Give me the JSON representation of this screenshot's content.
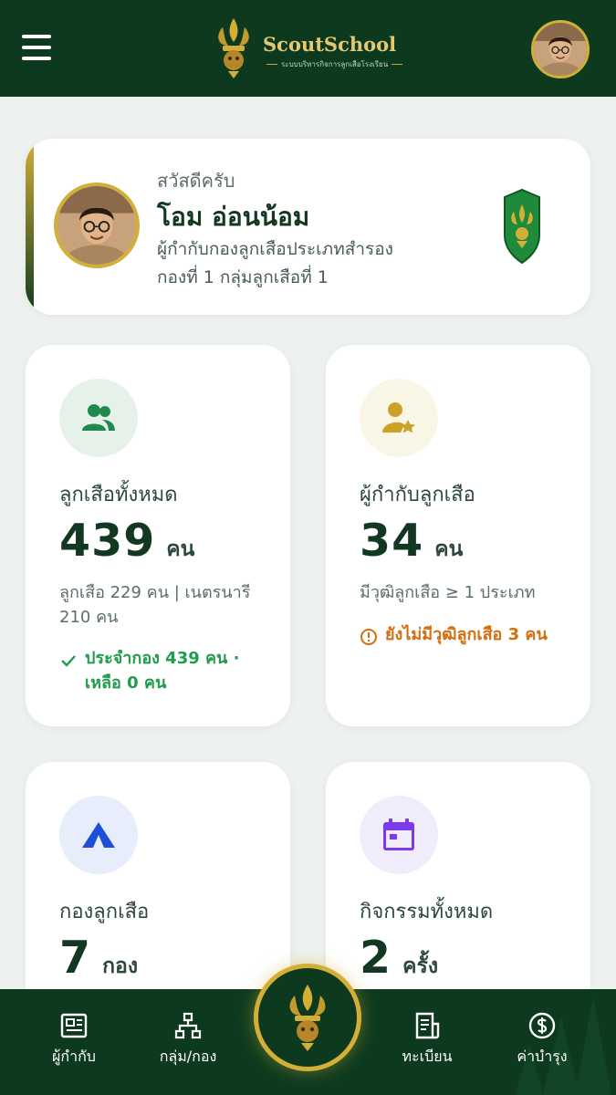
{
  "header": {
    "brand_name": "ScoutSchool",
    "brand_tagline": "ระบบบริหารกิจการลูกเสือโรงเรียน"
  },
  "profile": {
    "greeting": "สวัสดีครับ",
    "name": "โอม อ่อนน้อม",
    "role_line1": "ผู้กำกับกองลูกเสือประเภทสำรอง",
    "role_line2": "กองที่ 1 กลุ่มลูกเสือที่ 1"
  },
  "stats": {
    "scouts": {
      "title": "ลูกเสือทั้งหมด",
      "value": "439",
      "unit": "คน",
      "detail": "ลูกเสือ 229 คน | เนตรนารี 210 คน",
      "status": "ประจำกอง 439 คน · เหลือ 0 คน"
    },
    "leaders": {
      "title": "ผู้กำกับลูกเสือ",
      "value": "34",
      "unit": "คน",
      "detail": "มีวุฒิลูกเสือ ≥ 1 ประเภท",
      "status": "ยังไม่มีวุฒิลูกเสือ 3 คน"
    },
    "troops": {
      "title": "กองลูกเสือ",
      "value": "7",
      "unit": "กอง"
    },
    "activities": {
      "title": "กิจกรรมทั้งหมด",
      "value": "2",
      "unit": "ครั้ง"
    }
  },
  "nav": {
    "items": [
      {
        "label": "ผู้กำกับ",
        "icon": "id-card-icon"
      },
      {
        "label": "กลุ่ม/กอง",
        "icon": "org-chart-icon"
      },
      {
        "label": "ทะเบียน",
        "icon": "register-doc-icon"
      },
      {
        "label": "ค่าบำรุง",
        "icon": "dollar-coin-icon"
      }
    ],
    "center_icon": "scout-emblem-icon"
  },
  "colors": {
    "primary_green": "#0d3a1f",
    "gold": "#d4af37",
    "success_green": "#1f9d4c",
    "warning_orange": "#d46e0e",
    "purple": "#7c3aed",
    "blue": "#1d4ed8"
  }
}
